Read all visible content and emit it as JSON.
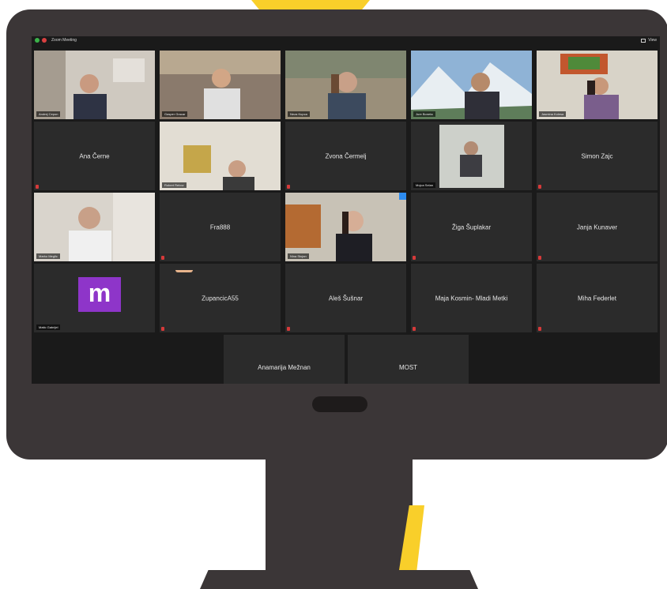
{
  "app": {
    "window_label": "Zoom Meeting",
    "view_label": "View",
    "colors": {
      "frame": "#3b3637",
      "screen": "#1a1a1a",
      "tile": "#2b2b2b",
      "accent": "#f9cf2a",
      "speaker": "#58c44e",
      "avatar": "#8e35c9"
    }
  },
  "participants": [
    {
      "name": "Andrej Cepon",
      "video": true
    },
    {
      "name": "Gasper Gracar",
      "video": true
    },
    {
      "name": "Neza Kupca",
      "video": true
    },
    {
      "name": "Jure Boneta",
      "video": true,
      "active_speaker": true
    },
    {
      "name": "Jasmina Kolesa",
      "video": true
    },
    {
      "name": "Ana Černe",
      "video": false
    },
    {
      "name": "Robert Rebov",
      "video": true
    },
    {
      "name": "Zvona Čermelj",
      "video": false
    },
    {
      "name": "Mojca Selan",
      "video": true
    },
    {
      "name": "Simon Zajc",
      "video": false
    },
    {
      "name": "Marko Meglic",
      "video": true
    },
    {
      "name": "Fra888",
      "video": false
    },
    {
      "name": "Nina Stojan",
      "video": true
    },
    {
      "name": "Žiga Šuplakar",
      "video": false
    },
    {
      "name": "Janja Kunaver",
      "video": false
    },
    {
      "name": "Matic Gabrijel",
      "video": false,
      "avatar_letter": "m"
    },
    {
      "name": "ZupancicA55",
      "video": false,
      "raised_hand": true
    },
    {
      "name": "Aleš Šušnar",
      "video": false
    },
    {
      "name": "Maja Kosmin- Mladi Metki",
      "video": false
    },
    {
      "name": "Miha Federlet",
      "video": false
    },
    {
      "name": "Anamarija Mežnan",
      "video": false
    },
    {
      "name": "MOST",
      "video": false
    }
  ]
}
